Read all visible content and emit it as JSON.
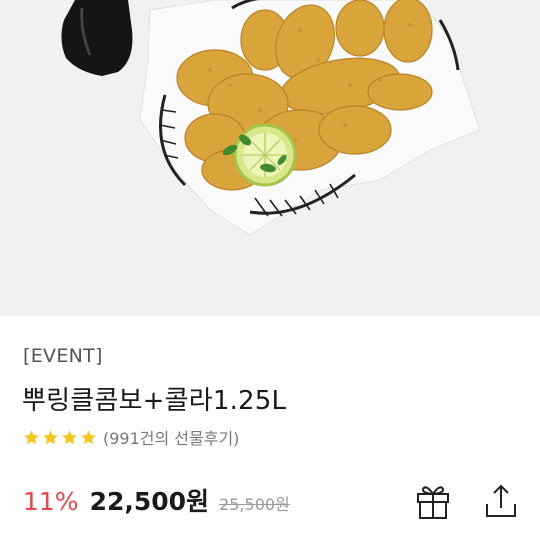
{
  "product": {
    "image_alt": "fried chicken basket with cola",
    "tag": "[EVENT]",
    "title": "뿌링클콤보+콜라1.25L",
    "rating_stars": 4,
    "review_count": "(991건의 선물후기)",
    "discount": "11%",
    "price": "22,500원",
    "original_price": "25,500원"
  },
  "actions": {
    "gift_icon": "gift-icon",
    "share_icon": "share-icon"
  },
  "colors": {
    "discount": "#e8474c",
    "star": "#f5c518",
    "hero_bg": "#f1f1f1"
  }
}
